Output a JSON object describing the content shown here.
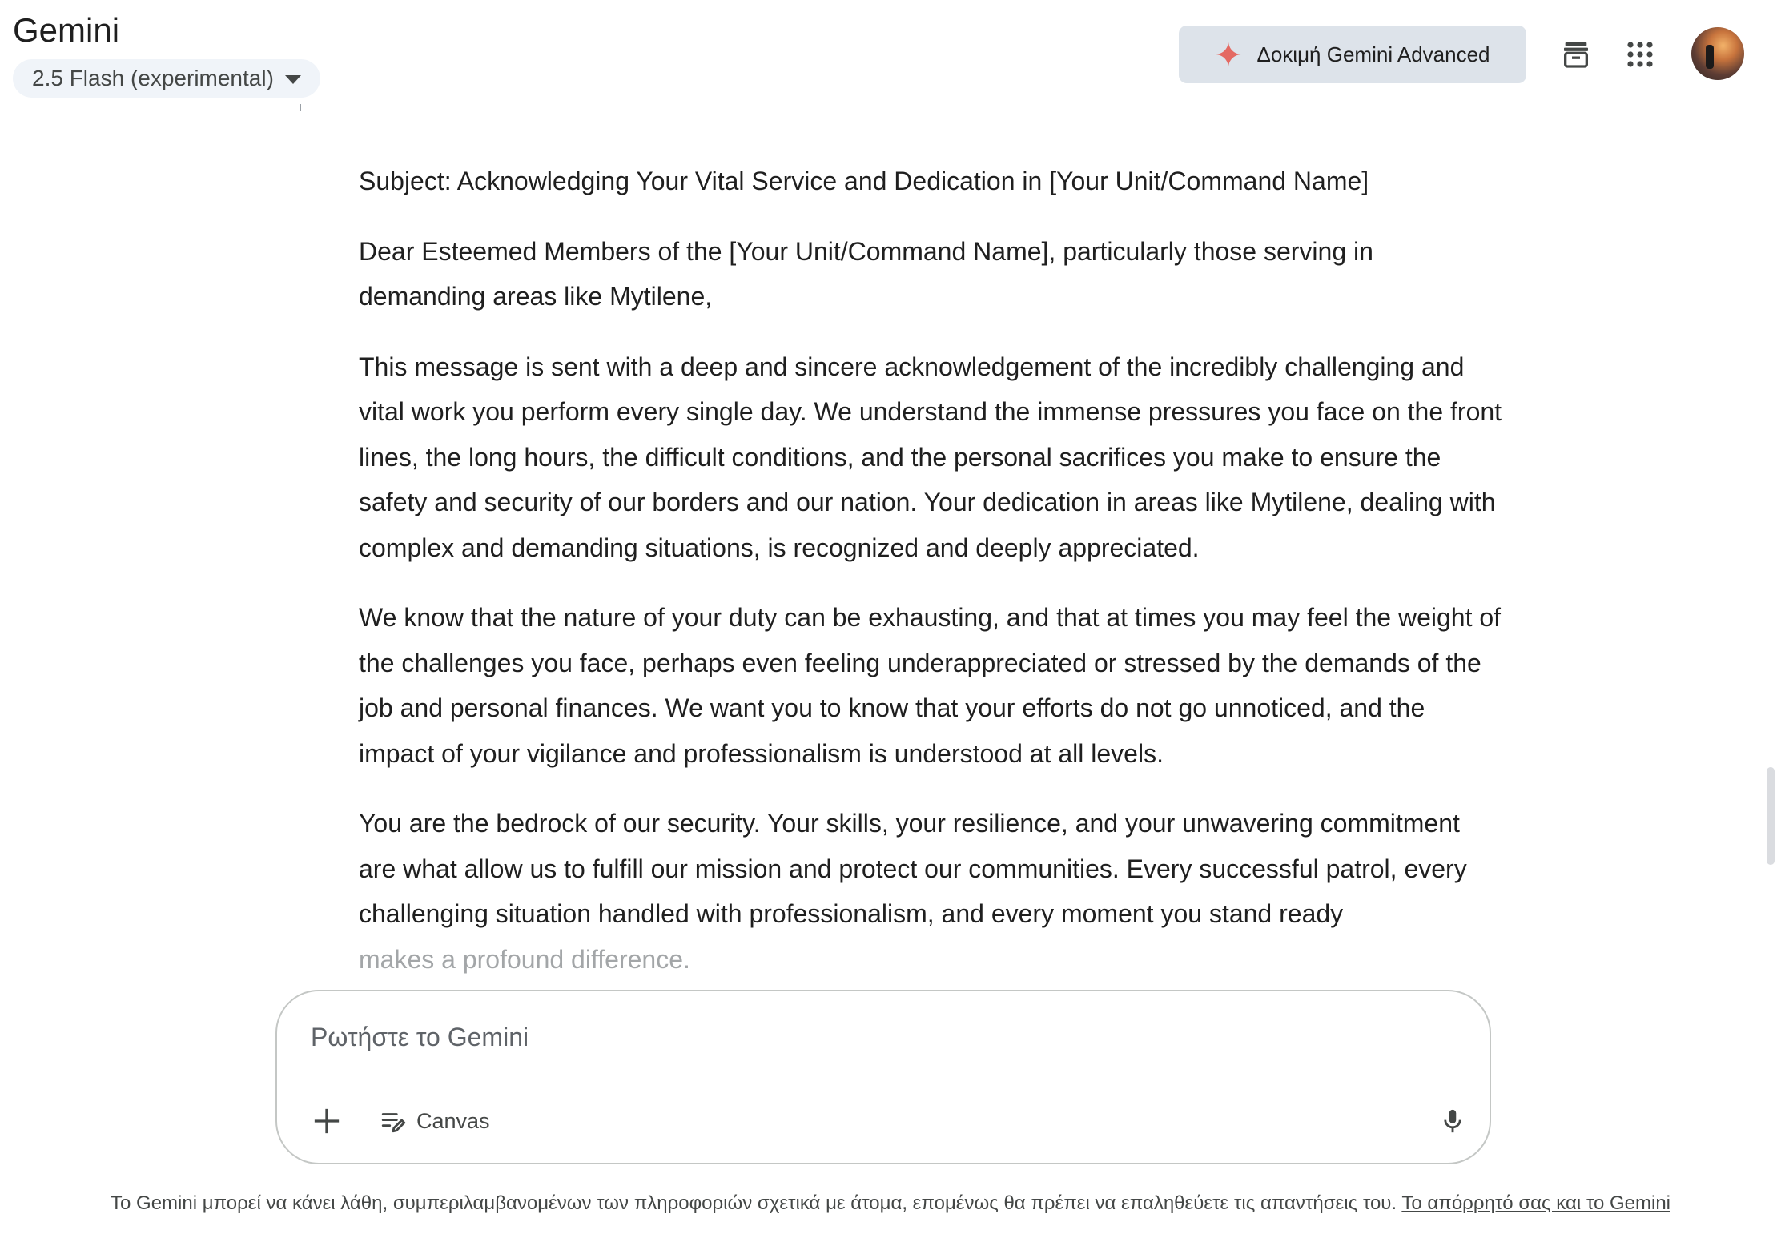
{
  "app": {
    "title": "Gemini",
    "model_selector": "2.5 Flash (experimental)"
  },
  "header": {
    "try_advanced_label": "Δοκιμή Gemini Advanced",
    "icons": [
      "sparkle-icon",
      "archive-icon",
      "apps-grid-icon",
      "avatar"
    ]
  },
  "message": {
    "paragraphs": [
      "Subject: Acknowledging Your Vital Service and Dedication in [Your Unit/Command Name]",
      "Dear Esteemed Members of the [Your Unit/Command Name], particularly those serving in demanding areas like Mytilene,",
      "This message is sent with a deep and sincere acknowledgement of the incredibly challenging and vital work you perform every single day. We understand the immense pressures you face on the front lines, the long hours, the difficult conditions, and the personal sacrifices you make to ensure the safety and security of our borders and our nation. Your dedication in areas like Mytilene, dealing with complex and demanding situations, is recognized and deeply appreciated.",
      "We know that the nature of your duty can be exhausting, and that at times you may feel the weight of the challenges you face, perhaps even feeling underappreciated or stressed by the demands of the job and personal finances. We want you to know that your efforts do not go unnoticed, and the impact of your vigilance and professionalism is understood at all levels.",
      "You are the bedrock of our security. Your skills, your resilience, and your unwavering commitment are what allow us to fulfill our mission and protect our communities. Every successful patrol, every challenging situation handled with professionalism, and every moment you stand ready"
    ],
    "faded_line": "makes a profound difference."
  },
  "input": {
    "placeholder": "Ρωτήστε το Gemini",
    "value": "",
    "canvas_label": "Canvas"
  },
  "footer": {
    "disclaimer": "Το Gemini μπορεί να κάνει λάθη, συμπεριλαμβανομένων των πληροφοριών σχετικά με άτομα, επομένως θα πρέπει να επαληθεύετε τις απαντήσεις του.",
    "privacy_link": "Το απόρρητό σας και το Gemini"
  },
  "colors": {
    "accent_spark": "#e46962",
    "advanced_button_bg": "#dde3ea",
    "model_pill_bg": "#f0f4f9",
    "text": "#1f1f1f",
    "muted_text": "#444746"
  }
}
